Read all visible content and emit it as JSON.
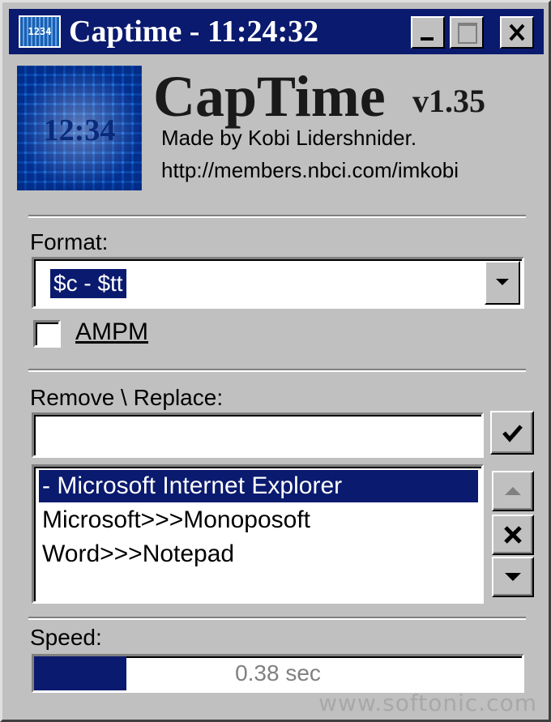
{
  "window": {
    "app_icon_text": "1234",
    "title": "Captime - 11:24:32"
  },
  "header": {
    "logo_time": "12:34",
    "app_name": "CapTime",
    "version": "v1.35",
    "credit": "Made by Kobi Lidershnider.",
    "url": "http://members.nbci.com/imkobi"
  },
  "format": {
    "label": "Format:",
    "value": "$c - $tt",
    "ampm_label": "AMPM",
    "ampm_checked": false
  },
  "remove_replace": {
    "label": "Remove \\ Replace:",
    "input_value": "",
    "items": [
      {
        "text": " - Microsoft Internet Explorer",
        "selected": true
      },
      {
        "text": "Microsoft>>>Monoposoft",
        "selected": false
      },
      {
        "text": "Word>>>Notepad",
        "selected": false
      }
    ]
  },
  "speed": {
    "label": "Speed:",
    "value_text": "0.38 sec",
    "fill_fraction": 0.19
  },
  "watermark": "www.softonic.com",
  "colors": {
    "titlebar": "#0a1a6e",
    "face": "#c0c0c0",
    "selection": "#0a1a6e"
  }
}
